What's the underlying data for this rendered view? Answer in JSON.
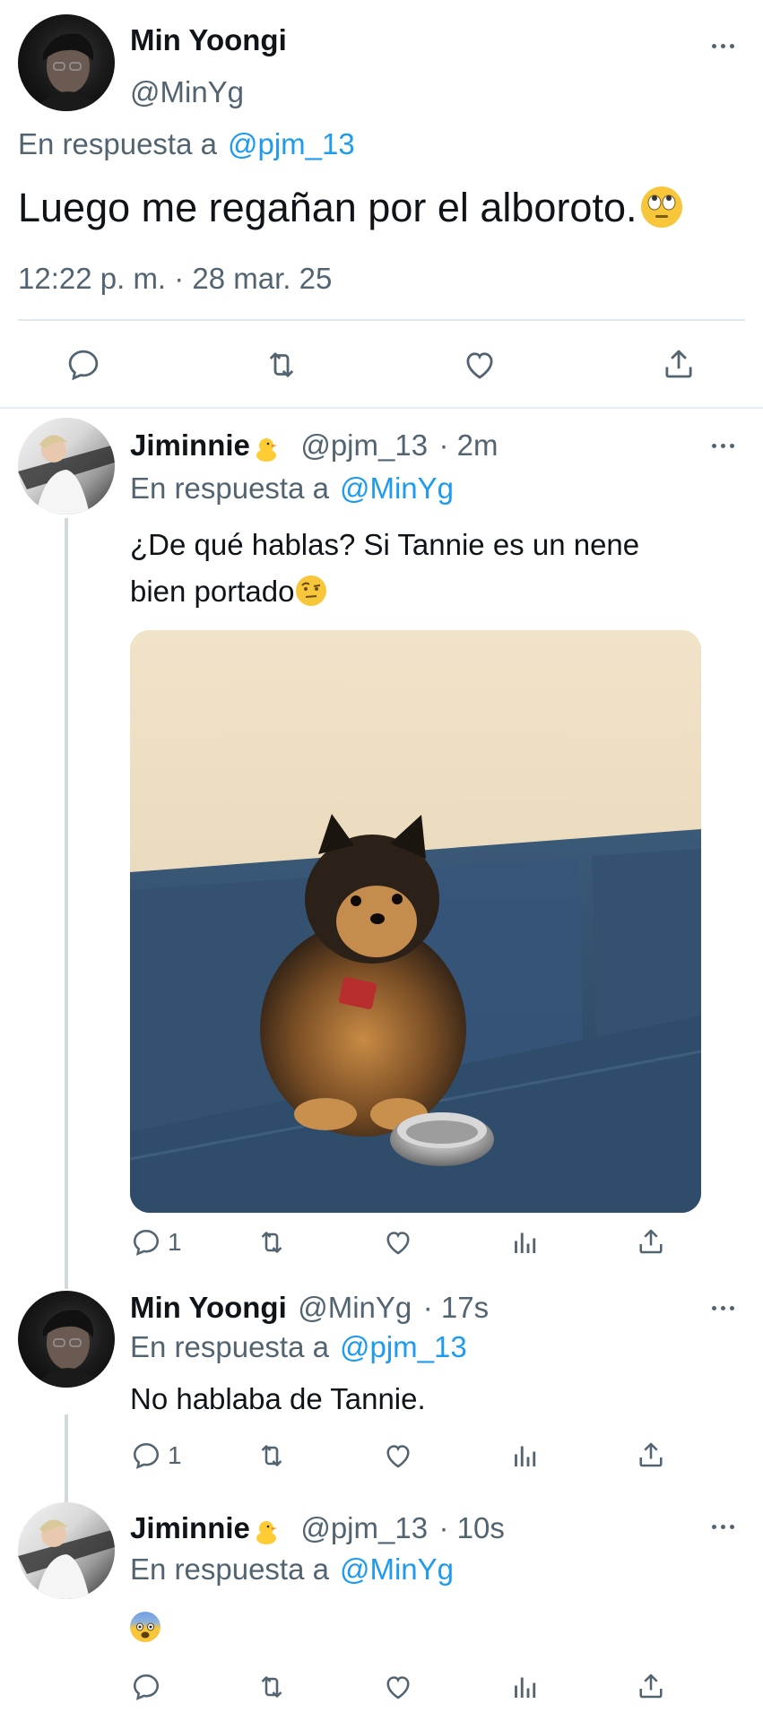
{
  "main_tweet": {
    "name": "Min Yoongi",
    "handle": "@MinYg",
    "reply_prefix": "En respuesta a",
    "reply_to": "@pjm_13",
    "text": "Luego me regañan por el alboroto.",
    "emoji": "rolling-eyes-emoji",
    "timestamp": "12:22 p. m. · 28 mar. 25"
  },
  "replies": [
    {
      "name": "Jiminnie",
      "name_emoji": "chick-emoji",
      "handle": "@pjm_13",
      "time": "· 2m",
      "reply_prefix": "En respuesta a",
      "reply_to": "@MinYg",
      "text_line1": "¿De qué hablas? Si Tannie es un nene",
      "text_line2": "bien portado",
      "text_emoji": "raised-eyebrow-emoji",
      "media": "photo-pomeranian-on-blue-couch",
      "reply_count": "1"
    },
    {
      "name": "Min Yoongi",
      "handle": "@MinYg",
      "time": "· 17s",
      "reply_prefix": "En respuesta a",
      "reply_to": "@pjm_13",
      "text": "No hablaba de Tannie.",
      "reply_count": "1"
    },
    {
      "name": "Jiminnie",
      "name_emoji": "chick-emoji",
      "handle": "@pjm_13",
      "time": "· 10s",
      "reply_prefix": "En respuesta a",
      "reply_to": "@MinYg",
      "text_emoji": "fearful-face-emoji"
    }
  ],
  "colors": {
    "link_blue": "#1d9bf0",
    "secondary_grey": "#536471",
    "divider": "#e1e8ed"
  }
}
